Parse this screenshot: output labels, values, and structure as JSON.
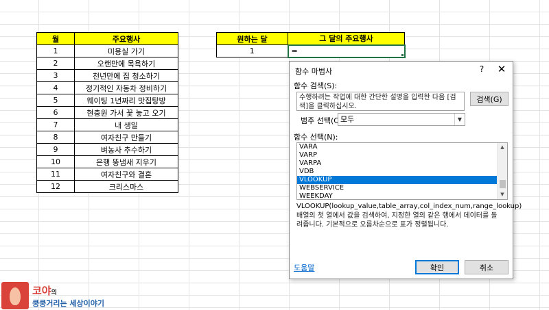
{
  "sheet": {
    "months_table": {
      "headers": [
        "월",
        "주요행사"
      ],
      "rows": [
        [
          "1",
          "미용실 가기"
        ],
        [
          "2",
          "오랜만에 목욕하기"
        ],
        [
          "3",
          "천년만에 집 청소하기"
        ],
        [
          "4",
          "정기적인 자동차 정비하기"
        ],
        [
          "5",
          "웨이팅 1년짜리 맛집탕방"
        ],
        [
          "6",
          "현충원 가서 꽃 놓고 오기"
        ],
        [
          "7",
          "내 생일"
        ],
        [
          "8",
          "여자친구 만들기"
        ],
        [
          "9",
          "벼농사 추수하기"
        ],
        [
          "10",
          "은행 뚱냄새 지우기"
        ],
        [
          "11",
          "여자친구와 결혼"
        ],
        [
          "12",
          "크리스마스"
        ]
      ]
    },
    "lookup_table": {
      "headers": [
        "원하는 달",
        "그 달의 주요행사"
      ],
      "month_value": "1",
      "formula_value": "="
    }
  },
  "dialog": {
    "title": "함수 마법사",
    "help": "?",
    "close": "✕",
    "search_label": "함수 검색(S):",
    "search_text": "수행하려는 작업에 대한 간단한 설명을 입력한 다음 [검색]을 클릭하십시오.",
    "search_button": "검색(G)",
    "category_label": "범주 선택(C):",
    "category_value": "모두",
    "function_label": "함수 선택(N):",
    "functions": [
      "VARA",
      "VARP",
      "VARPA",
      "VDB",
      "VLOOKUP",
      "WEBSERVICE",
      "WEEKDAY"
    ],
    "selected_function": "VLOOKUP",
    "syntax": "VLOOKUP(lookup_value,table_array,col_index_num,range_lookup)",
    "description": "배열의 첫 열에서 값을 검색하여, 지정한 열의 같은 행에서 데이터를 돌려줍니다. 기본적으로 오름차순으로 표가 정렬됩니다.",
    "help_link": "도움말",
    "ok_button": "확인",
    "cancel_button": "취소"
  },
  "watermark": {
    "title": "코야",
    "title_suffix": "의",
    "subtitle": "쿵쿵거리는 세상이야기"
  }
}
